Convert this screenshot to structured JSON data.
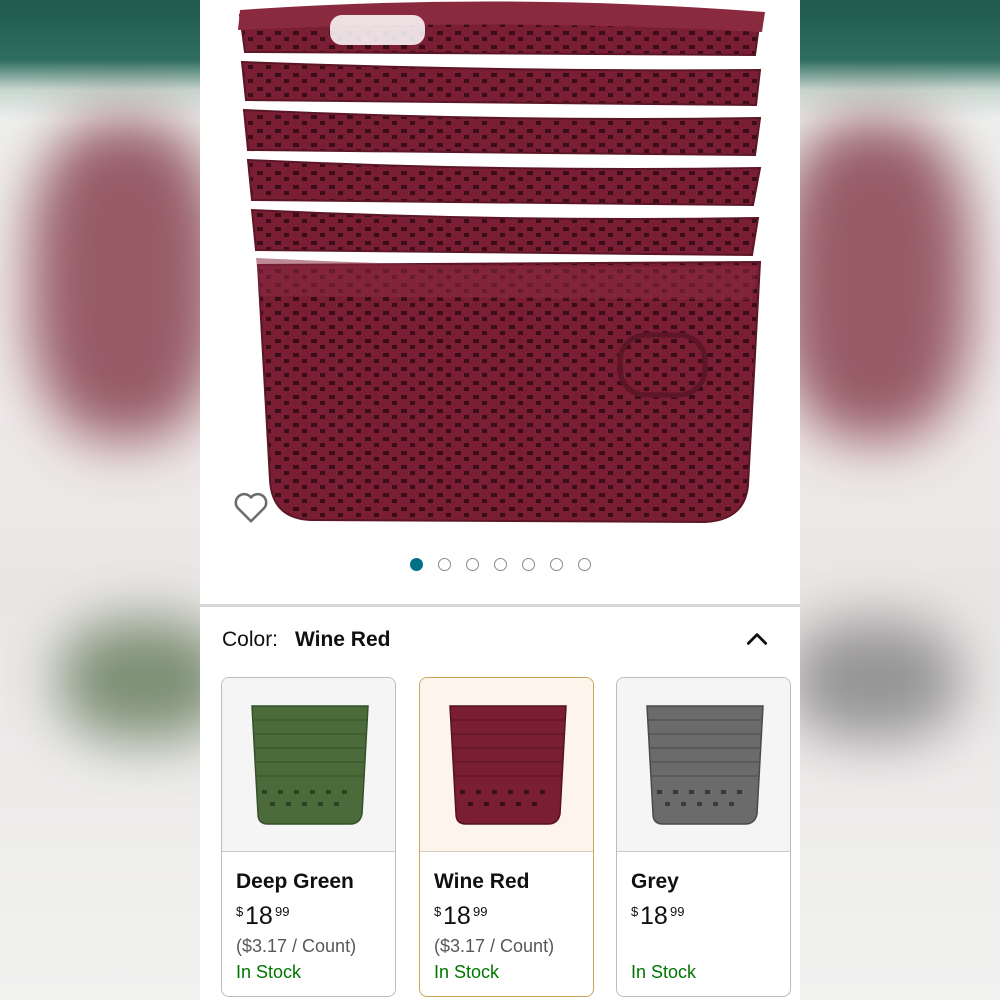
{
  "colors": {
    "basket_red": "#7a1f33",
    "basket_green": "#4c6b3a",
    "basket_grey": "#6b6b6b",
    "accent_teal": "#007185",
    "stock_green": "#007600",
    "selected_border": "#c9a45a"
  },
  "product": {
    "image_icon": "basket-stack-image",
    "wishlist_icon": "heart-outline-icon",
    "carousel": {
      "count": 7,
      "active_index": 0
    }
  },
  "variation": {
    "label": "Color:",
    "selected": "Wine Red",
    "collapse_icon": "chevron-up-icon",
    "options": [
      {
        "name": "Deep Green",
        "price_symbol": "$",
        "price_whole": "18",
        "price_fraction": "99",
        "unit_price": "($3.17 / Count)",
        "availability": "In Stock"
      },
      {
        "name": "Wine Red",
        "price_symbol": "$",
        "price_whole": "18",
        "price_fraction": "99",
        "unit_price": "($3.17 / Count)",
        "availability": "In Stock"
      },
      {
        "name": "Grey",
        "price_symbol": "$",
        "price_whole": "18",
        "price_fraction": "99",
        "unit_price": "",
        "availability": "In Stock"
      }
    ]
  }
}
